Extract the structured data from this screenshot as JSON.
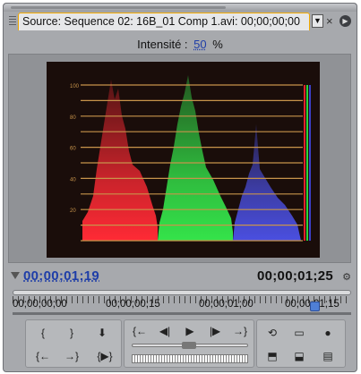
{
  "panel": {
    "tab_label": "Source: Sequence 02: 16B_01 Comp 1.avi: 00;00;00;00",
    "dropdown_glyph": "▼",
    "close_glyph": "×",
    "menu_glyph": "▶"
  },
  "scope": {
    "intensity_label": "Intensité :",
    "intensity_value": "50",
    "intensity_unit": "%",
    "scale": [
      "100",
      "80",
      "60",
      "40",
      "20"
    ],
    "colors": {
      "red": "#e0232b",
      "green": "#2ad63a",
      "blue": "#3b3fc8",
      "grid": "#c8944b"
    }
  },
  "timecode": {
    "current": "00;00;01;19",
    "duration": "00;00;01;25"
  },
  "ruler": {
    "labels": [
      "00;00;00;00",
      "00;00;00;15",
      "00;00;01;00",
      "00;00;01;15"
    ]
  },
  "controls": {
    "mark_in": "{",
    "mark_out": "}",
    "set_marker": "⬇",
    "goto_in": "{←",
    "step_back": "◀|",
    "play": "▶",
    "step_fwd": "|▶",
    "goto_out": "→}",
    "goto_prev_edit": "{←",
    "goto_next_edit": "→}",
    "play_in_out": "{▶}",
    "loop": "⟲",
    "safe_margins": "▭",
    "output": "●",
    "insert": "⬒",
    "overlay": "⬓",
    "export_frame": "▤"
  }
}
